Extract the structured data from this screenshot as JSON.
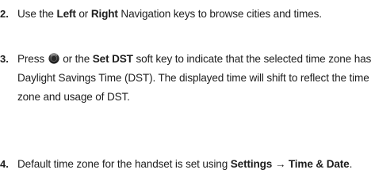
{
  "steps": [
    {
      "number": "2.",
      "parts": [
        "Use the ",
        "Left",
        " or ",
        "Right",
        " Navigation keys to browse cities and times."
      ]
    },
    {
      "number": "3.",
      "parts": [
        "Press ",
        " or the ",
        "Set DST",
        " soft key to indicate that the selected time zone has Daylight Savings Time (DST). The displayed time will shift to reflect the time zone and usage of DST."
      ],
      "icon": "ok-key-icon"
    },
    {
      "number": "4.",
      "parts": [
        "Default time zone for the handset is set using ",
        "Settings → Time & Date",
        "."
      ]
    }
  ]
}
